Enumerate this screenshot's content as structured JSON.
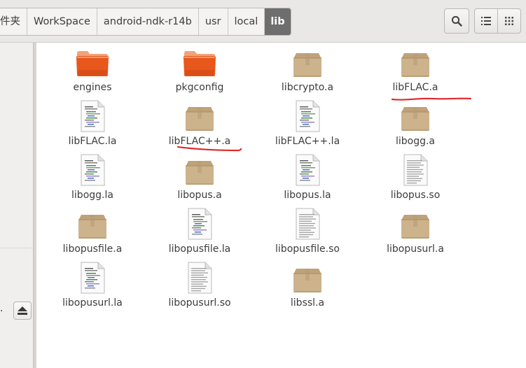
{
  "breadcrumb": [
    "件夹",
    "WorkSpace",
    "android-ndk-r14b",
    "usr",
    "local",
    "lib"
  ],
  "toolbar": {
    "search_icon": "search-icon",
    "list_view_icon": "list-view-icon",
    "grid_view_icon": "grid-view-icon"
  },
  "sidebar": {
    "partial_text": "."
  },
  "files": [
    {
      "name": "engines",
      "icon": "folder"
    },
    {
      "name": "pkgconfig",
      "icon": "folder"
    },
    {
      "name": "libcrypto.a",
      "icon": "package"
    },
    {
      "name": "libFLAC.a",
      "icon": "package"
    },
    {
      "name": "libFLAC.la",
      "icon": "script"
    },
    {
      "name": "libFLAC++.a",
      "icon": "package"
    },
    {
      "name": "libFLAC++.la",
      "icon": "script"
    },
    {
      "name": "libogg.a",
      "icon": "package"
    },
    {
      "name": "libogg.la",
      "icon": "script"
    },
    {
      "name": "libopus.a",
      "icon": "package"
    },
    {
      "name": "libopus.la",
      "icon": "script"
    },
    {
      "name": "libopus.so",
      "icon": "text"
    },
    {
      "name": "libopusfile.a",
      "icon": "package"
    },
    {
      "name": "libopusfile.la",
      "icon": "script"
    },
    {
      "name": "libopusfile.so",
      "icon": "text"
    },
    {
      "name": "libopusurl.a",
      "icon": "package"
    },
    {
      "name": "libopusurl.la",
      "icon": "script"
    },
    {
      "name": "libopusurl.so",
      "icon": "text"
    },
    {
      "name": "libssl.a",
      "icon": "package"
    }
  ],
  "colors": {
    "folder": "#e8571c",
    "package": "#cdb38c",
    "annotation": "#e0262a"
  }
}
